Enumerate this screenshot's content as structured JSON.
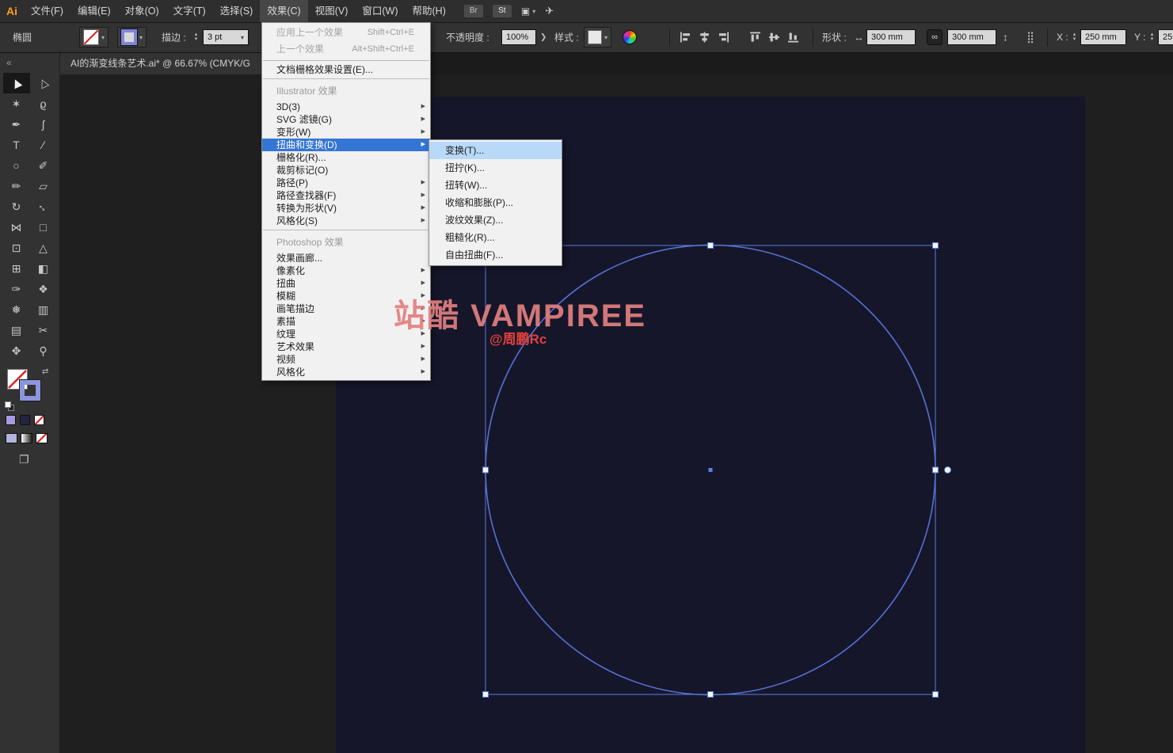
{
  "colors": {
    "menu_highlight": "#3575d4",
    "submenu_highlight": "#b9d9f8",
    "artboard_background": "#16162b",
    "circle_stroke": "#5571d4",
    "selection_blue": "#5b7fe0",
    "watermark_pink": "#e2807f",
    "watermark_red": "#e0413c"
  },
  "icons": {
    "chevron_down": "▾",
    "stepper_up": "▴",
    "stepper_down": "▾",
    "opacity_chevron": "❯",
    "width": "↔",
    "height": "↕",
    "link": "∞",
    "grid": "⣿",
    "share": "✈",
    "workspace": "▣",
    "swap": "⇄",
    "screen_mode": "❐",
    "collapse": "«",
    "submenu_arrow": "▶"
  },
  "menubar": {
    "logo_text": "Ai",
    "items": [
      {
        "label": "文件(F)"
      },
      {
        "label": "编辑(E)"
      },
      {
        "label": "对象(O)"
      },
      {
        "label": "文字(T)"
      },
      {
        "label": "选择(S)"
      },
      {
        "label": "效果(C)",
        "open": true
      },
      {
        "label": "视图(V)"
      },
      {
        "label": "窗口(W)"
      },
      {
        "label": "帮助(H)"
      }
    ],
    "badge_bridge": "Br",
    "badge_stock": "St"
  },
  "controlbar": {
    "tool_label": "椭圆",
    "stroke_label": "描边 :",
    "stroke_weight": "3 pt",
    "opacity_label": "不透明度 :",
    "opacity_value": "100%",
    "style_label": "样式 :",
    "shape_label": "形状 :",
    "shape_width": "300 mm",
    "shape_height": "300 mm",
    "x_label": "X :",
    "x_value": "250 mm",
    "y_label": "Y :",
    "y_value": "25",
    "align_icons": [
      "align-horizontal-left-icon",
      "align-horizontal-center-icon",
      "align-horizontal-right-icon",
      "align-vertical-top-icon",
      "align-vertical-middle-icon",
      "align-vertical-bottom-icon"
    ]
  },
  "document_tab": {
    "title": "AI的渐变线条艺术.ai* @ 66.67% (CMYK/G"
  },
  "toolbar": {
    "tools": [
      {
        "name": "selection-tool",
        "glyph": "▶",
        "selected": true
      },
      {
        "name": "direct-selection-tool",
        "glyph": "▷"
      },
      {
        "name": "magic-wand-tool",
        "glyph": "✶"
      },
      {
        "name": "lasso-tool",
        "glyph": "ϱ"
      },
      {
        "name": "pen-tool",
        "glyph": "✒"
      },
      {
        "name": "curvature-tool",
        "glyph": "ʃ"
      },
      {
        "name": "type-tool",
        "glyph": "T"
      },
      {
        "name": "line-segment-tool",
        "glyph": "∕"
      },
      {
        "name": "ellipse-tool",
        "glyph": "○"
      },
      {
        "name": "paintbrush-tool",
        "glyph": "✐"
      },
      {
        "name": "pencil-tool",
        "glyph": "✏"
      },
      {
        "name": "eraser-tool",
        "glyph": "▱"
      },
      {
        "name": "rotate-tool",
        "glyph": "↻"
      },
      {
        "name": "scale-tool",
        "glyph": "↔"
      },
      {
        "name": "width-tool",
        "glyph": "⋈"
      },
      {
        "name": "free-transform-tool",
        "glyph": "□"
      },
      {
        "name": "shape-builder-tool",
        "glyph": "⊡"
      },
      {
        "name": "perspective-grid-tool",
        "glyph": "△"
      },
      {
        "name": "mesh-tool",
        "glyph": "⊞"
      },
      {
        "name": "gradient-tool",
        "glyph": "◧"
      },
      {
        "name": "eyedropper-tool",
        "glyph": "✑"
      },
      {
        "name": "blend-tool",
        "glyph": "❖"
      },
      {
        "name": "symbol-sprayer-tool",
        "glyph": "❅"
      },
      {
        "name": "column-graph-tool",
        "glyph": "▥"
      },
      {
        "name": "artboard-tool",
        "glyph": "▤"
      },
      {
        "name": "slice-tool",
        "glyph": "✂"
      },
      {
        "name": "hand-tool",
        "glyph": "✥"
      },
      {
        "name": "zoom-tool",
        "glyph": "⚲"
      }
    ]
  },
  "effect_menu": {
    "items": [
      {
        "label": "应用上一个效果",
        "shortcut": "Shift+Ctrl+E",
        "disabled": true
      },
      {
        "label": "上一个效果",
        "shortcut": "Alt+Shift+Ctrl+E",
        "disabled": true
      },
      {
        "type": "separator"
      },
      {
        "label": "文档栅格效果设置(E)..."
      },
      {
        "type": "separator"
      },
      {
        "type": "header",
        "label": "Illustrator 效果"
      },
      {
        "label": "3D(3)",
        "submenu": true
      },
      {
        "label": "SVG 滤镜(G)",
        "submenu": true
      },
      {
        "label": "变形(W)",
        "submenu": true
      },
      {
        "label": "扭曲和变换(D)",
        "submenu": true,
        "highlighted": true
      },
      {
        "label": "栅格化(R)..."
      },
      {
        "label": "裁剪标记(O)"
      },
      {
        "label": "路径(P)",
        "submenu": true
      },
      {
        "label": "路径查找器(F)",
        "submenu": true
      },
      {
        "label": "转换为形状(V)",
        "submenu": true
      },
      {
        "label": "风格化(S)",
        "submenu": true
      },
      {
        "type": "separator"
      },
      {
        "type": "header",
        "label": "Photoshop 效果"
      },
      {
        "label": "效果画廊..."
      },
      {
        "label": "像素化",
        "submenu": true
      },
      {
        "label": "扭曲",
        "submenu": true
      },
      {
        "label": "模糊",
        "submenu": true
      },
      {
        "label": "画笔描边",
        "submenu": true
      },
      {
        "label": "素描",
        "submenu": true
      },
      {
        "label": "纹理",
        "submenu": true
      },
      {
        "label": "艺术效果",
        "submenu": true
      },
      {
        "label": "视频",
        "submenu": true
      },
      {
        "label": "风格化",
        "submenu": true
      }
    ]
  },
  "transform_submenu": {
    "items": [
      {
        "label": "变换(T)...",
        "highlighted": true
      },
      {
        "label": "扭拧(K)..."
      },
      {
        "label": "扭转(W)..."
      },
      {
        "label": "收缩和膨胀(P)..."
      },
      {
        "label": "波纹效果(Z)..."
      },
      {
        "label": "粗糙化(R)..."
      },
      {
        "label": "自由扭曲(F)..."
      }
    ]
  },
  "watermark": {
    "title": "站酷 VAMPIREE",
    "author": "@周鹏Rc"
  }
}
